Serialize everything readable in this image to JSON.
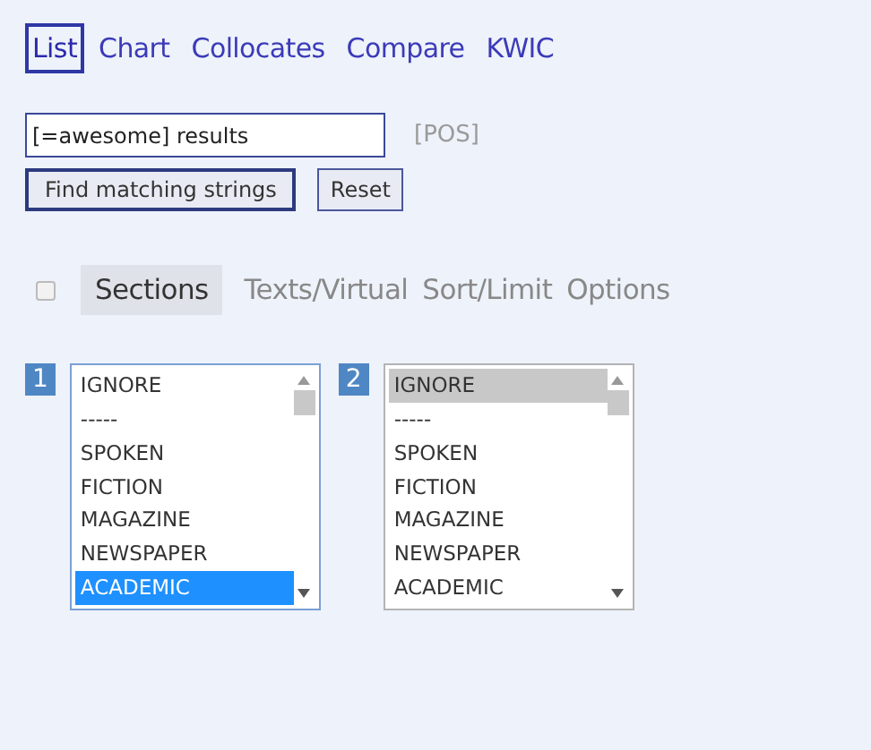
{
  "tabs": [
    {
      "label": "List",
      "selected": true
    },
    {
      "label": "Chart",
      "selected": false
    },
    {
      "label": "Collocates",
      "selected": false
    },
    {
      "label": "Compare",
      "selected": false
    },
    {
      "label": "KWIC",
      "selected": false
    }
  ],
  "search": {
    "value": "[=awesome] results",
    "pos_link": "[POS]"
  },
  "buttons": [
    {
      "label": "Find matching strings",
      "kind": "primary"
    },
    {
      "label": "Reset",
      "kind": "secondary"
    }
  ],
  "options_checkbox": {
    "checked": false
  },
  "option_tabs": [
    {
      "label": "Sections",
      "selected": true
    },
    {
      "label": "Texts/Virtual",
      "selected": false
    },
    {
      "label": "Sort/Limit",
      "selected": false
    },
    {
      "label": "Options",
      "selected": false
    }
  ],
  "section_lists": [
    {
      "number": "1",
      "focused": true,
      "items": [
        {
          "label": "IGNORE",
          "selected": false
        },
        {
          "label": "-----",
          "selected": false
        },
        {
          "label": "SPOKEN",
          "selected": false
        },
        {
          "label": "FICTION",
          "selected": false
        },
        {
          "label": "MAGAZINE",
          "selected": false
        },
        {
          "label": "NEWSPAPER",
          "selected": false
        },
        {
          "label": "ACADEMIC",
          "selected": true
        }
      ]
    },
    {
      "number": "2",
      "focused": false,
      "items": [
        {
          "label": "IGNORE",
          "selected": true
        },
        {
          "label": "-----",
          "selected": false
        },
        {
          "label": "SPOKEN",
          "selected": false
        },
        {
          "label": "FICTION",
          "selected": false
        },
        {
          "label": "MAGAZINE",
          "selected": false
        },
        {
          "label": "NEWSPAPER",
          "selected": false
        },
        {
          "label": "ACADEMIC",
          "selected": false
        }
      ]
    }
  ]
}
